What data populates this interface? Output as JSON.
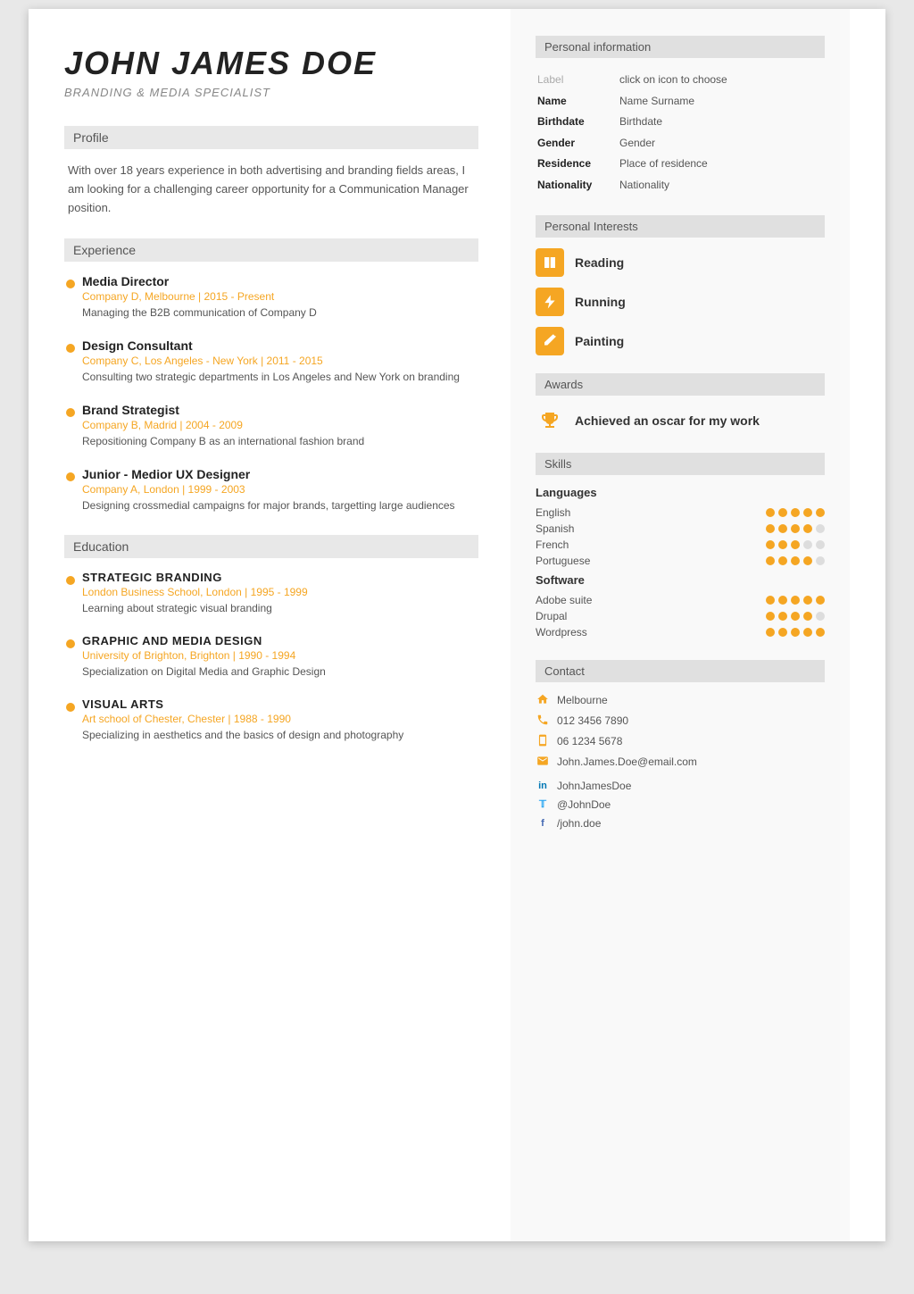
{
  "left": {
    "name": "JOHN JAMES  DOE",
    "subtitle": "BRANDING & MEDIA SPECIALIST",
    "sections": {
      "profile": {
        "header": "Profile",
        "text": "With over 18 years experience in both advertising and branding fields areas, I am looking for a challenging career opportunity for a Communication Manager position."
      },
      "experience": {
        "header": "Experience",
        "items": [
          {
            "title": "Media Director",
            "company": "Company D, Melbourne | 2015 - Present",
            "desc": "Managing the B2B communication of Company D"
          },
          {
            "title": "Design Consultant",
            "company": "Company C, Los Angeles - New York | 2011 - 2015",
            "desc": "Consulting two strategic departments in Los Angeles and New York on branding"
          },
          {
            "title": "Brand Strategist",
            "company": "Company B, Madrid | 2004 - 2009",
            "desc": "Repositioning Company B as an international fashion brand"
          },
          {
            "title": "Junior - Medior UX Designer",
            "company": "Company A, London | 1999 - 2003",
            "desc": "Designing crossmedial campaigns for major brands, targetting large audiences"
          }
        ]
      },
      "education": {
        "header": "Education",
        "items": [
          {
            "title": "STRATEGIC BRANDING",
            "company": "London Business School, London | 1995 - 1999",
            "desc": "Learning about strategic visual branding"
          },
          {
            "title": "GRAPHIC AND MEDIA DESIGN",
            "company": "University of Brighton, Brighton | 1990 - 1994",
            "desc": "Specialization on Digital Media and Graphic Design"
          },
          {
            "title": "VISUAL ARTS",
            "company": "Art school of Chester, Chester | 1988 - 1990",
            "desc": "Specializing in aesthetics and the basics of design and photography"
          }
        ]
      }
    }
  },
  "right": {
    "personal_info": {
      "header": "Personal information",
      "label_col": "click on icon to choose",
      "rows": [
        {
          "key": "Label",
          "value": "click on icon to choose"
        },
        {
          "key": "Name",
          "value": "Name Surname"
        },
        {
          "key": "Birthdate",
          "value": "Birthdate"
        },
        {
          "key": "Gender",
          "value": "Gender"
        },
        {
          "key": "Residence",
          "value": "Place of residence"
        },
        {
          "key": "Nationality",
          "value": "Nationality"
        }
      ]
    },
    "interests": {
      "header": "Personal Interests",
      "items": [
        {
          "label": "Reading",
          "icon": "book"
        },
        {
          "label": "Running",
          "icon": "bolt"
        },
        {
          "label": "Painting",
          "icon": "paint"
        }
      ]
    },
    "awards": {
      "header": "Awards",
      "items": [
        {
          "text": "Achieved an oscar for my work"
        }
      ]
    },
    "skills": {
      "header": "Skills",
      "languages": {
        "title": "Languages",
        "items": [
          {
            "name": "English",
            "dots": 5,
            "filled": 5
          },
          {
            "name": "Spanish",
            "dots": 5,
            "filled": 4
          },
          {
            "name": "French",
            "dots": 5,
            "filled": 3
          },
          {
            "name": "Portuguese",
            "dots": 5,
            "filled": 4
          }
        ]
      },
      "software": {
        "title": "Software",
        "items": [
          {
            "name": "Adobe suite",
            "dots": 5,
            "filled": 5
          },
          {
            "name": "Drupal",
            "dots": 5,
            "filled": 4
          },
          {
            "name": "Wordpress",
            "dots": 5,
            "filled": 5
          }
        ]
      }
    },
    "contact": {
      "header": "Contact",
      "items": [
        {
          "icon": "home",
          "text": "Melbourne"
        },
        {
          "icon": "phone",
          "text": "012 3456 7890"
        },
        {
          "icon": "mobile",
          "text": "06 1234 5678"
        },
        {
          "icon": "email",
          "text": "John.James.Doe@email.com"
        }
      ],
      "social": [
        {
          "icon": "in",
          "text": "JohnJamesDoe"
        },
        {
          "icon": "tw",
          "text": "@JohnDoe"
        },
        {
          "icon": "fb",
          "text": "/john.doe"
        }
      ]
    }
  }
}
